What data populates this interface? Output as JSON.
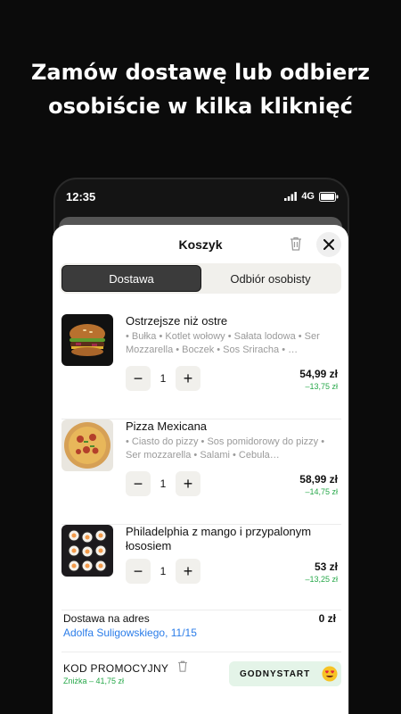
{
  "headline": {
    "line1": "Zamów dostawę lub odbierz",
    "line2": "osobiście w kilka kliknięć"
  },
  "status_bar": {
    "time": "12:35",
    "network": "4G"
  },
  "cart": {
    "title": "Koszyk",
    "tabs": [
      {
        "label": "Dostawa",
        "active": true
      },
      {
        "label": "Odbiór osobisty",
        "active": false
      }
    ],
    "items": [
      {
        "name": "Ostrzejsze niż ostre",
        "description": "• Bułka • Kotlet wołowy • Sałata lodowa • Ser Mozzarella • Boczek • Sos Sriracha • …",
        "quantity": "1",
        "price": "54,99 zł",
        "discount": "–13,75 zł",
        "image": "burger"
      },
      {
        "name": "Pizza Mexicana",
        "description": "• Ciasto do pizzy • Sos pomidorowy do pizzy • Ser mozzarella • Salami • Cebula…",
        "quantity": "1",
        "price": "58,99 zł",
        "discount": "–14,75 zł",
        "image": "pizza"
      },
      {
        "name": "Philadelphia z mango i przypalonym łososiem",
        "description": "",
        "quantity": "1",
        "price": "53 zł",
        "discount": "–13,25 zł",
        "image": "sushi"
      }
    ],
    "delivery": {
      "label": "Dostawa na adres",
      "address": "Adolfa Suligowskiego, 11/15",
      "price": "0 zł"
    },
    "promo": {
      "label": "KOD PROMOCYJNY",
      "discount": "Zniżka – 41,75 zł",
      "code": "GODNYSTART"
    }
  },
  "colors": {
    "background": "#0b0b0b",
    "accent_green": "#27a84a",
    "link_blue": "#2b7de9",
    "promo_bg": "#e4f4e8"
  }
}
